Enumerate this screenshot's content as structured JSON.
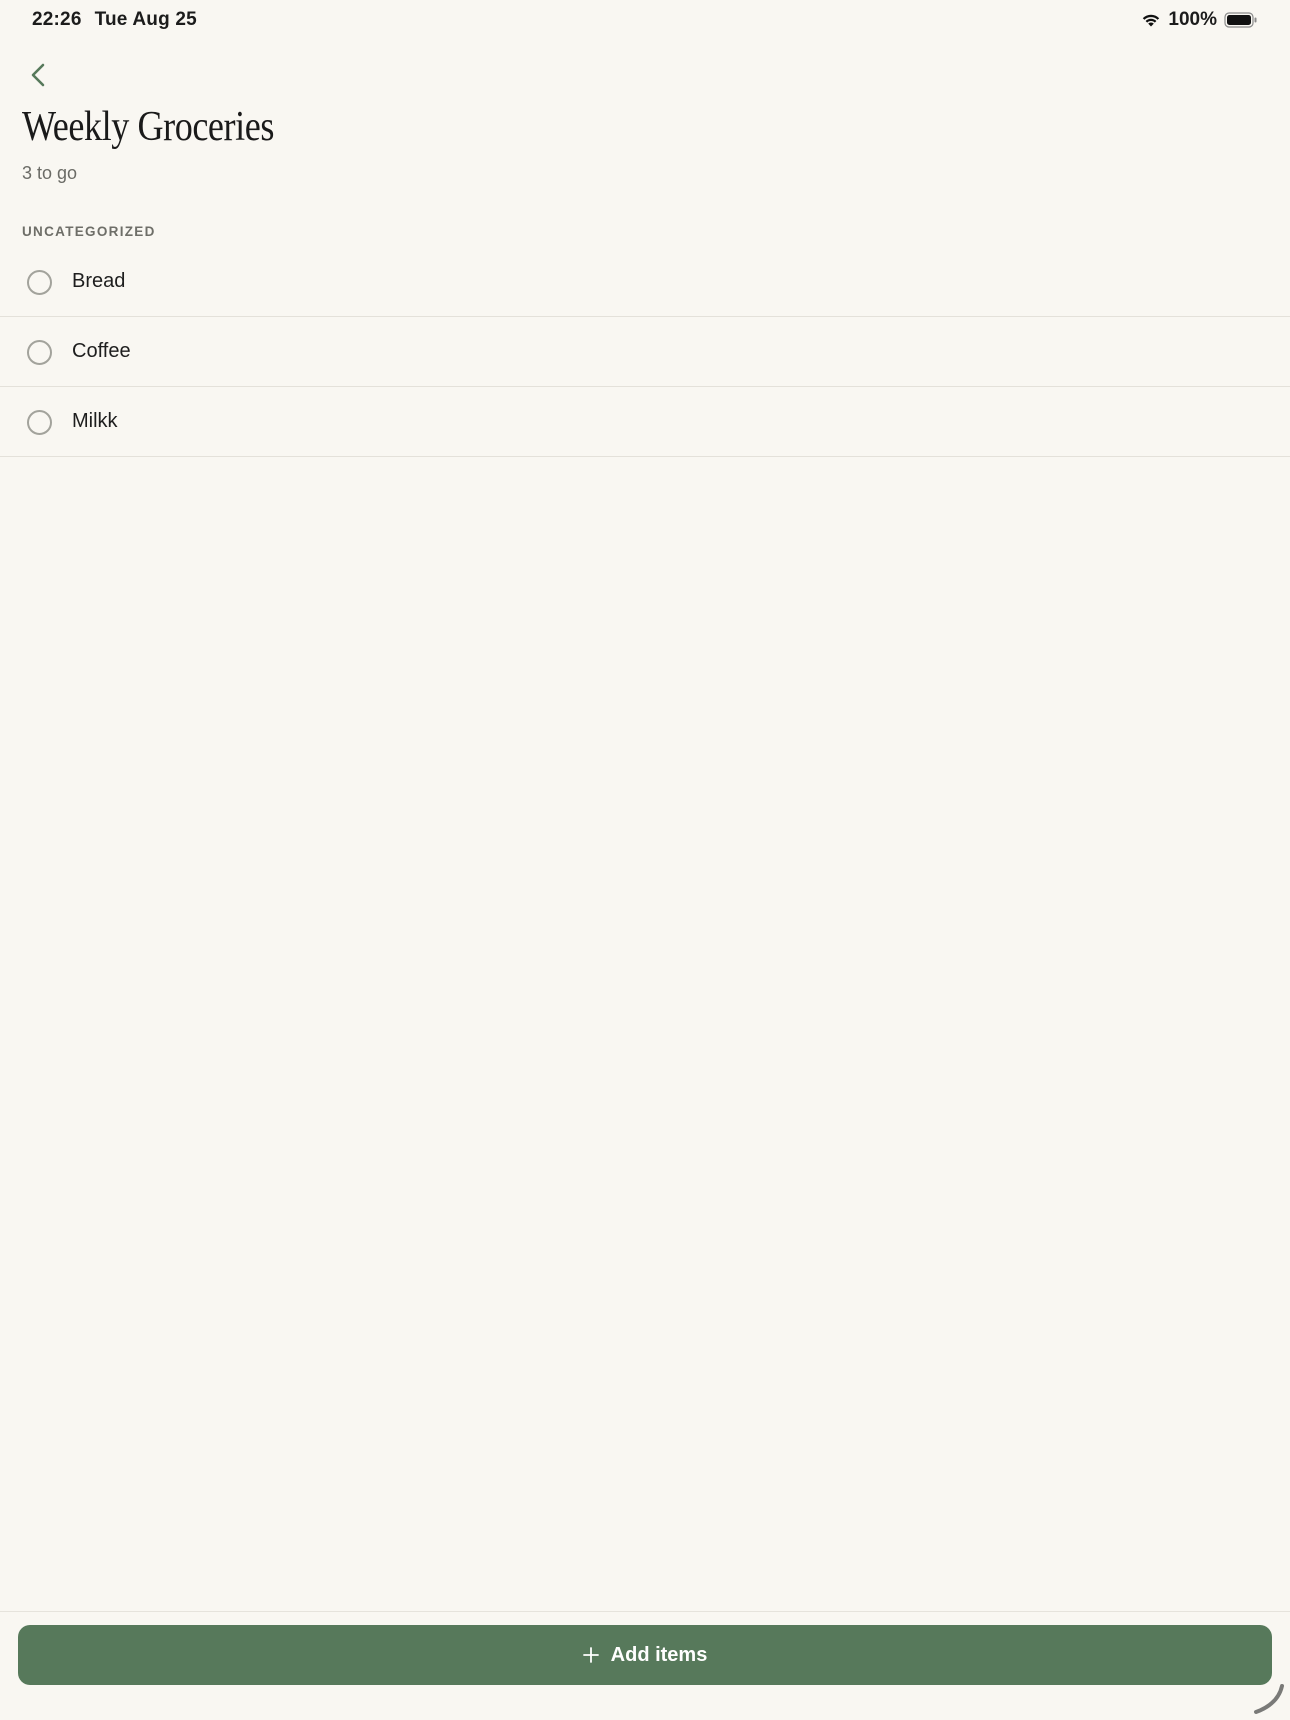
{
  "status_bar": {
    "time": "22:26",
    "date": "Tue Aug 25",
    "battery_percent": "100%",
    "battery_level": 1.0
  },
  "header": {
    "title": "Weekly Groceries",
    "remaining": "3 to go"
  },
  "section": {
    "name": "UNCATEGORIZED"
  },
  "items": [
    {
      "label": "Bread",
      "checked": false
    },
    {
      "label": "Coffee",
      "checked": false
    },
    {
      "label": "Milkk",
      "checked": false
    }
  ],
  "footer": {
    "add_label": "Add items"
  },
  "colors": {
    "background": "#F9F7F2",
    "accent": "#57795B",
    "divider": "#E4E1DA"
  },
  "icons": {
    "back": "chevron-left-icon",
    "add": "plus-icon",
    "wifi": "wifi-icon",
    "battery": "battery-icon"
  }
}
